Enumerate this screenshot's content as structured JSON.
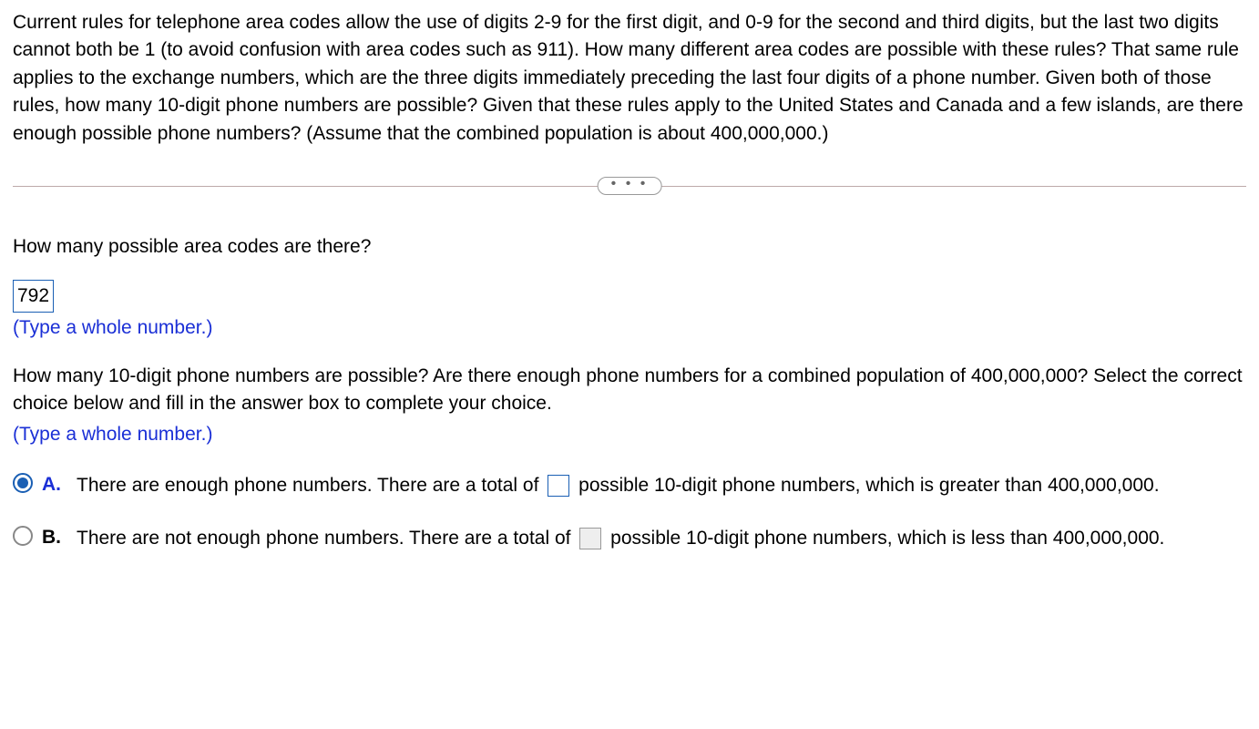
{
  "problem": "Current rules for telephone area codes allow the use of digits 2-9 for the first digit, and 0-9 for the second and third digits, but the last two digits cannot both be 1 (to avoid confusion with area codes such as 911). How many different area codes are possible with these rules? That same rule applies to the exchange numbers, which are the three digits immediately preceding the last four digits of a phone number. Given both of those rules, how many 10-digit phone numbers are possible? Given that these rules apply to the United States and Canada and a few islands, are there enough possible phone numbers? (Assume that the combined population is about 400,000,000.)",
  "ellipsis": "• • •",
  "q1": {
    "prompt": "How many possible area codes are there?",
    "answer": "792",
    "hint": "(Type a whole number.)"
  },
  "q2": {
    "prompt": "How many 10-digit phone numbers are possible? Are there enough phone numbers for a combined population of 400,000,000? Select the correct choice below and fill in the answer box to complete your choice.",
    "hint": "(Type a whole number.)"
  },
  "choices": {
    "a": {
      "label": "A.",
      "pre": "There are enough phone numbers. There are a total of",
      "post": "possible 10-digit phone numbers, which is greater than 400,000,000."
    },
    "b": {
      "label": "B.",
      "pre": "There are not enough phone numbers. There are a total of",
      "post": "possible 10-digit phone numbers, which is less than 400,000,000."
    }
  }
}
